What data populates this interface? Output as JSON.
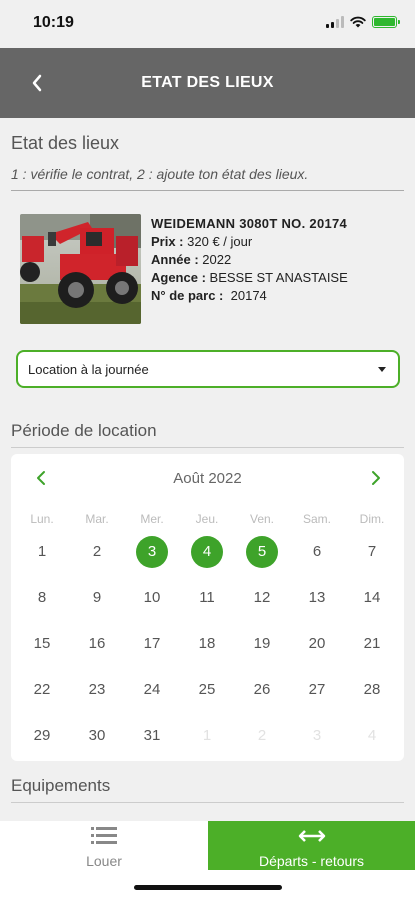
{
  "status_bar": {
    "time": "10:19"
  },
  "header": {
    "title": "ETAT DES LIEUX",
    "back_icon": "chevron-left-icon"
  },
  "main": {
    "title": "Etat des lieux",
    "subtitle": "1 : vérifie le contrat, 2 : ajoute ton état des lieux.",
    "machine": {
      "name": "WEIDEMANN 3080T NO. 20174",
      "price_label": "Prix :",
      "price_value": "320 € / jour",
      "year_label": "Année :",
      "year_value": "2022",
      "agency_label": "Agence :",
      "agency_value": "BESSE ST ANASTAISE",
      "park_label": "N° de parc :",
      "park_value": "20174"
    },
    "rental_type": {
      "selected": "Location à la journée"
    },
    "period_title": "Période de location",
    "calendar": {
      "month": "Août 2022",
      "weekdays": [
        "Lun.",
        "Mar.",
        "Mer.",
        "Jeu.",
        "Ven.",
        "Sam.",
        "Dim."
      ],
      "weeks": [
        [
          "1",
          "2",
          "3",
          "4",
          "5",
          "6",
          "7"
        ],
        [
          "8",
          "9",
          "10",
          "11",
          "12",
          "13",
          "14"
        ],
        [
          "15",
          "16",
          "17",
          "18",
          "19",
          "20",
          "21"
        ],
        [
          "22",
          "23",
          "24",
          "25",
          "26",
          "27",
          "28"
        ],
        [
          "29",
          "30",
          "31",
          "1",
          "2",
          "3",
          "4"
        ]
      ],
      "selected_days": [
        "3",
        "4",
        "5"
      ]
    },
    "equipment_title": "Equipements"
  },
  "tabbar": {
    "louer_label": "Louer",
    "departs_label": "Départs - retours"
  },
  "colors": {
    "accent": "#4caf28",
    "header_bg": "#666666"
  }
}
